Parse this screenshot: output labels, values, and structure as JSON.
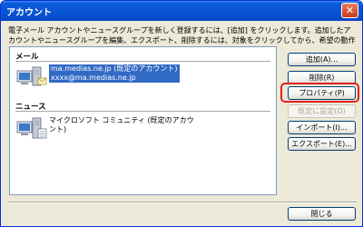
{
  "window": {
    "title": "アカウント",
    "close_glyph": "✕"
  },
  "description": "電子メール アカウントやニュースグループを新しく登録するには、[追加] をクリックします。追加したアカウントやニュースグループを編集、エクスポート、削除するには、対象をクリックしてから、希望の動作をクリックします。",
  "groups": {
    "mail": {
      "header": "メール",
      "account_line1": "ma.medias.ne.jp (既定のアカウント)",
      "account_line2": "xxxx@ma.medias.ne.jp"
    },
    "news": {
      "header": "ニュース",
      "account_text": "マイクロソフト コミュニティ (既定のアカウント)"
    }
  },
  "buttons": {
    "add": "追加(A)...",
    "delete": "削除(R)",
    "properties": "プロパティ(P)",
    "set_default": "既定に設定(D)",
    "import": "インポート(I)...",
    "export": "エクスポート(E)...",
    "close": "閉じる"
  },
  "colors": {
    "highlight": "#e0211f",
    "selection": "#316ac5",
    "titlebar": "#0a54d4"
  },
  "icons": {
    "mail_account": "mail-server-icon",
    "news_account": "news-server-icon"
  }
}
